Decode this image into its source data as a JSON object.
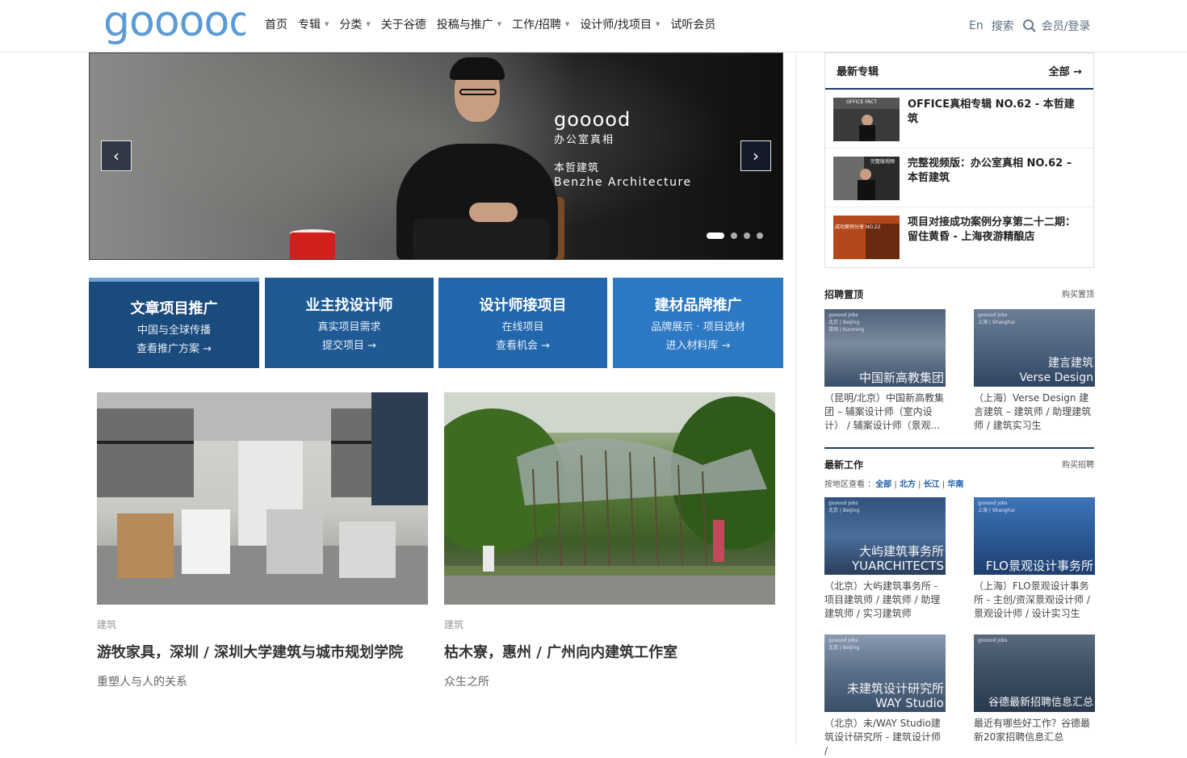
{
  "header": {
    "logo": "gooood",
    "nav": [
      {
        "label": "首页",
        "caret": false
      },
      {
        "label": "专辑",
        "caret": true
      },
      {
        "label": "分类",
        "caret": true
      },
      {
        "label": "关于谷德",
        "caret": false
      },
      {
        "label": "投稿与推广",
        "caret": true
      },
      {
        "label": "工作/招聘",
        "caret": true
      },
      {
        "label": "设计师/找项目",
        "caret": true
      },
      {
        "label": "试听会员",
        "caret": false
      }
    ],
    "lang": "En",
    "search": "搜索",
    "login": "会员/登录"
  },
  "slider": {
    "logo": "gooood",
    "subtitle": "办公室真相",
    "firm_cn": "本哲建筑",
    "firm_en": "Benzhe Architecture",
    "prev": "‹",
    "next": "›",
    "slides": 4,
    "active": 1
  },
  "promos": [
    {
      "title": "文章项目推广",
      "line1": "中国与全球传播",
      "line2": "查看推广方案 →"
    },
    {
      "title": "业主找设计师",
      "line1": "真实项目需求",
      "line2": "提交项目 →"
    },
    {
      "title": "设计师接项目",
      "line1": "在线项目",
      "line2": "查看机会 →"
    },
    {
      "title": "建材品牌推广",
      "line1": "品牌展示 · 项目选材",
      "line2": "进入材料库 →"
    }
  ],
  "articles": [
    {
      "category": "建筑",
      "title": "游牧家具，深圳 / 深圳大学建筑与城市规划学院",
      "subtitle": "重塑人与人的关系"
    },
    {
      "category": "建筑",
      "title": "枯木寮，惠州 / 广州向内建筑工作室",
      "subtitle": "众生之所"
    }
  ],
  "sidebar": {
    "zhuanji": {
      "title": "最新专辑",
      "all": "全部 →",
      "items": [
        {
          "title": "OFFICE真相专辑 NO.62 - 本哲建筑",
          "thumb_text": "OFFICE FACT"
        },
        {
          "title": "完整视频版：办公室真相 NO.62 – 本哲建筑",
          "thumb_text": "完整版视频"
        },
        {
          "title": "项目对接成功案例分享第二十二期：留住黄昏 - 上海夜游精酿店",
          "thumb_text": "成功案例分享 NO.22"
        }
      ]
    },
    "pinned": {
      "title": "招聘置顶",
      "buy": "购买置顶",
      "jobs": [
        {
          "city_tag": "北京 | Beijing\n昆明 | Kunming",
          "img_text": "中国新高教集团",
          "text": "（昆明/北京）中国新高教集团 – 辅案设计师（室内设计） / 辅案设计师（景观..."
        },
        {
          "city_tag": "上海 | Shanghai",
          "img_text": "建言建筑\nVerse Design",
          "text": "（上海）Verse Design 建言建筑 – 建筑师 / 助理建筑师 / 建筑实习生"
        }
      ]
    },
    "latest": {
      "title": "最新工作",
      "buy": "购买招聘",
      "region_label": "按地区查看 ：",
      "regions": [
        "全部",
        "北方",
        "长江",
        "华南"
      ],
      "jobs": [
        {
          "city_tag": "北京 | Beijing",
          "img_text": "大屿建筑事务所\nYUARCHITECTS",
          "text": "（北京）大屿建筑事务所 - 项目建筑师 / 建筑师 / 助理建筑师 / 实习建筑师"
        },
        {
          "city_tag": "上海 | Shanghai",
          "img_text": "FLO景观设计事务所",
          "text": "（上海）FLO景观设计事务所 - 主创/资深景观设计师 / 景观设计师 / 设计实习生 /..."
        },
        {
          "city_tag": "北京 | Beijing",
          "img_text": "未建筑设计研究所\nWAY Studio",
          "text": "（北京）未/WAY Studio建筑设计研究所 - 建筑设计师 /"
        },
        {
          "city_tag": "",
          "img_text": "谷德最新招聘信息汇总",
          "text": "最近有哪些好工作？谷德最新20家招聘信息汇总"
        }
      ]
    }
  }
}
